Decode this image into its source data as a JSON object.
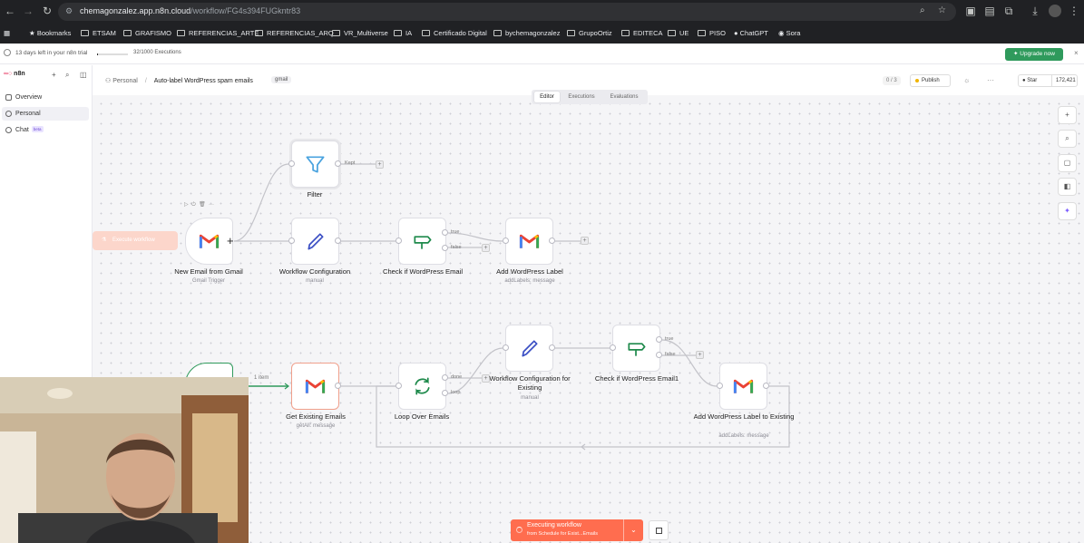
{
  "browser": {
    "url_host": "chemagonzalez.app.n8n.cloud",
    "url_path": "/workflow/FG4s394FUGkntr83",
    "bookmarks": [
      "Bookmarks",
      "ETSAM",
      "GRAFISMO",
      "REFERENCIAS_ARTE",
      "REFERENCIAS_ARQ",
      "VR_Multiverse",
      "IA",
      "Certificado Digital",
      "bychemagonzalez",
      "GrupoOrtiz",
      "EDITECA",
      "UE",
      "PISO",
      "ChatGPT",
      "Sora"
    ]
  },
  "trial": {
    "text": "13 days left in your n8n trial",
    "executions": "32/1000 Executions",
    "upgrade": "Upgrade now"
  },
  "sidebar": {
    "logo": "n8n",
    "items": [
      {
        "label": "Overview"
      },
      {
        "label": "Personal"
      },
      {
        "label": "Chat",
        "badge": "beta"
      }
    ]
  },
  "header": {
    "crumb_parent": "Personal",
    "title": "Auto-label WordPress spam emails",
    "tag": "gmail",
    "counter": "0 / 3",
    "publish": "Publish",
    "star": "Star",
    "stars": "172,421"
  },
  "tabs": [
    "Editor",
    "Executions",
    "Evaluations"
  ],
  "canvas": {
    "execute_workflow": "Execute workflow",
    "nodes": [
      {
        "name": "Filter",
        "sub": ""
      },
      {
        "name": "New Email from Gmail",
        "sub": "Gmail Trigger"
      },
      {
        "name": "Workflow Configuration",
        "sub": "manual"
      },
      {
        "name": "Check if WordPress Email",
        "sub": ""
      },
      {
        "name": "Add WordPress Label",
        "sub": "addLabels: message"
      },
      {
        "name": "Workflow Configuration for Existing",
        "sub": "manual"
      },
      {
        "name": "Check if WordPress Email1",
        "sub": ""
      },
      {
        "name": "Get Existing Emails",
        "sub": "getAll: message"
      },
      {
        "name": "Loop Over Emails",
        "sub": ""
      },
      {
        "name": "Add WordPress Label to Existing",
        "sub": "addLabels: message"
      }
    ],
    "port_labels": {
      "kept": "Kept",
      "true1": "true",
      "false1": "false",
      "done": "done",
      "loop": "loop",
      "true2": "true",
      "false2": "false",
      "items": "1 item"
    }
  },
  "exec_bar": {
    "title": "Executing workflow",
    "subtitle": "from Schedule for Exist...Emails"
  },
  "colors": {
    "accent": "#ff6d4f",
    "upgrade": "#2f9a5c",
    "gmail_red": "#ea4335",
    "filter_blue": "#4aa3df",
    "edit_blue": "#3b4fc4",
    "if_green": "#1f8a4c"
  }
}
